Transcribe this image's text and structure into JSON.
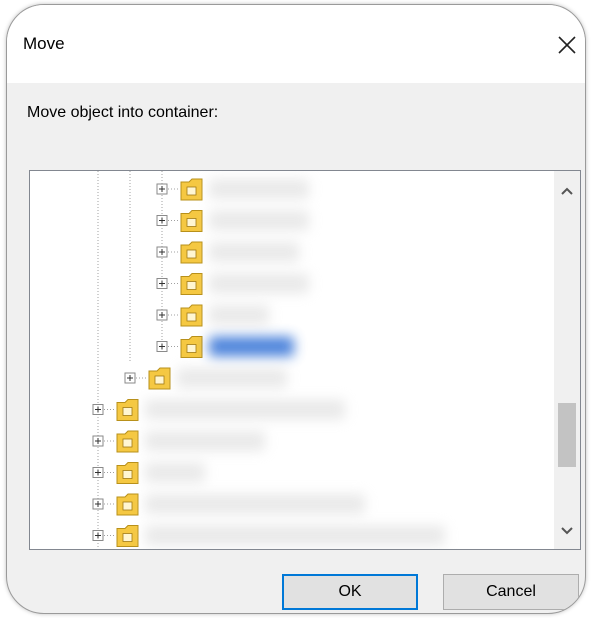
{
  "dialog": {
    "title": "Move",
    "prompt": "Move object into container:",
    "ok_label": "OK",
    "cancel_label": "Cancel"
  },
  "tree": {
    "nodes": [
      {
        "level": 2,
        "expandable": true,
        "label": "",
        "selected": false
      },
      {
        "level": 2,
        "expandable": true,
        "label": "",
        "selected": false
      },
      {
        "level": 2,
        "expandable": true,
        "label": "",
        "selected": false
      },
      {
        "level": 2,
        "expandable": true,
        "label": "",
        "selected": false
      },
      {
        "level": 2,
        "expandable": true,
        "label": "",
        "selected": false
      },
      {
        "level": 2,
        "expandable": true,
        "label": "",
        "selected": true
      },
      {
        "level": 1,
        "expandable": true,
        "label": "",
        "selected": false
      },
      {
        "level": 0,
        "expandable": true,
        "label": "",
        "selected": false
      },
      {
        "level": 0,
        "expandable": true,
        "label": "",
        "selected": false
      },
      {
        "level": 0,
        "expandable": true,
        "label": "",
        "selected": false
      },
      {
        "level": 0,
        "expandable": true,
        "label": "",
        "selected": false
      },
      {
        "level": 0,
        "expandable": true,
        "label": "",
        "selected": false
      },
      {
        "level": 0,
        "expandable": true,
        "label": "",
        "selected": false
      }
    ],
    "scroll_position": 0.6
  },
  "colors": {
    "accent": "#0078d7",
    "selection": "#3c78d8",
    "folder": "#f5c842"
  },
  "icons": {
    "close": "close-icon",
    "scroll_up": "chevron-up-icon",
    "scroll_down": "chevron-down-icon",
    "expand": "plus-box-icon",
    "folder": "folder-icon"
  }
}
